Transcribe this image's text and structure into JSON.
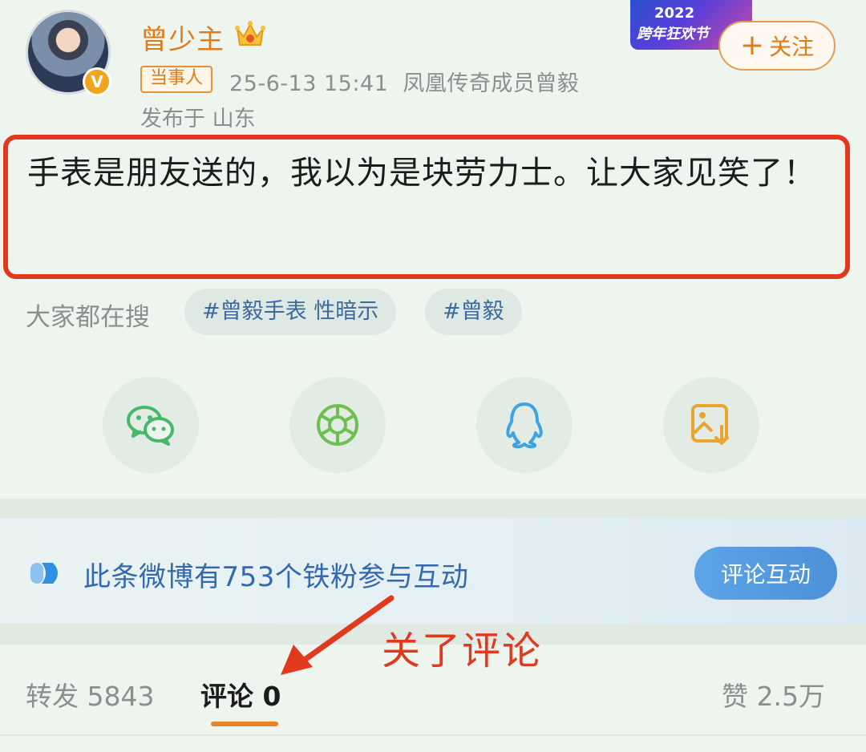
{
  "header": {
    "username": "曾少主",
    "role_badge": "当事人",
    "meta": "25-6-13 15:41  凤凰传奇成员曾毅",
    "location": "发布于 山东",
    "promo_year": "2022",
    "promo_text": "跨年狂欢节",
    "follow_label": "关注",
    "follow_plus": "+"
  },
  "post": {
    "text": "手表是朋友送的，我以为是块劳力士。让大家见笑了！"
  },
  "searches": {
    "label": "大家都在搜",
    "tags": [
      "#曾毅手表 性暗示",
      "#曾毅"
    ]
  },
  "share": {
    "icons": [
      "wechat-icon",
      "moments-icon",
      "qq-icon",
      "save-image-icon"
    ]
  },
  "fans": {
    "text": "此条微博有753个铁粉参与互动",
    "button": "评论互动"
  },
  "annotation": {
    "text": "关了评论"
  },
  "tabs": {
    "repost": "转发 5843",
    "comment": "评论 0",
    "like": "赞 2.5万"
  },
  "colors": {
    "accent": "#e07b1b",
    "annotation_red": "#e0391e",
    "link_blue": "#3569ad"
  }
}
